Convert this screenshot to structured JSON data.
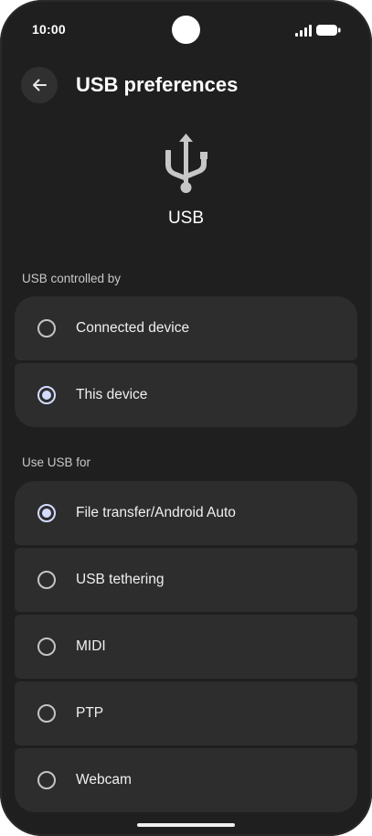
{
  "status_bar": {
    "time": "10:00",
    "icons": [
      "signal-icon",
      "battery-icon"
    ]
  },
  "header": {
    "title": "USB preferences",
    "back_icon": "arrow-left-icon"
  },
  "hero": {
    "icon": "usb-icon",
    "label": "USB"
  },
  "controlled_by": {
    "header": "USB controlled by",
    "options": [
      {
        "label": "Connected device",
        "selected": false
      },
      {
        "label": "This device",
        "selected": true
      }
    ]
  },
  "use_for": {
    "header": "Use USB for",
    "options": [
      {
        "label": "File transfer/Android Auto",
        "selected": true
      },
      {
        "label": "USB tethering",
        "selected": false
      },
      {
        "label": "MIDI",
        "selected": false
      },
      {
        "label": "PTP",
        "selected": false
      },
      {
        "label": "Webcam",
        "selected": false
      }
    ]
  },
  "colors": {
    "background": "#1f1f1f",
    "card": "#2d2d2d",
    "accent": "#d3dbff",
    "text": "#ffffff"
  }
}
